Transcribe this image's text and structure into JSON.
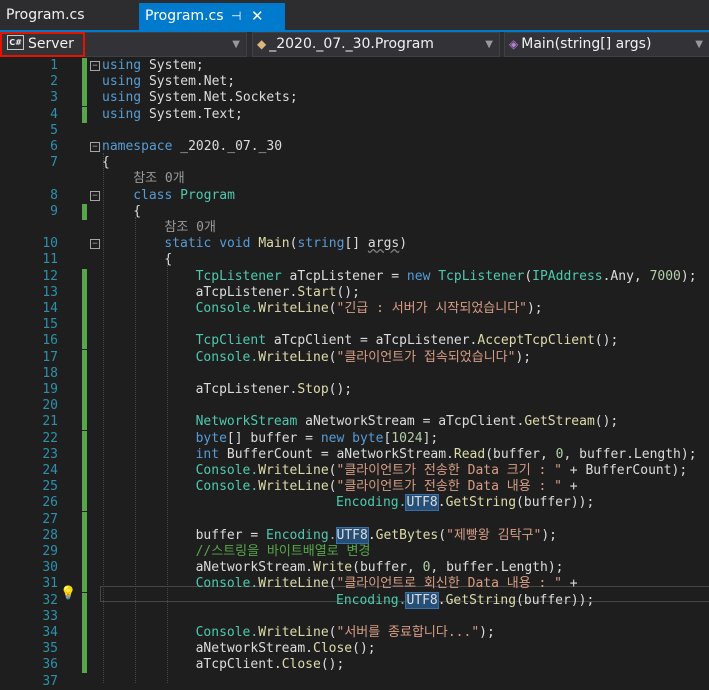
{
  "tabs": [
    {
      "label": "Program.cs",
      "active": false
    },
    {
      "label": "Program.cs",
      "active": true,
      "pin": "⊣",
      "close": "✕"
    }
  ],
  "navbar": {
    "project": "Server",
    "project_icon": "C#",
    "type": "_2020._07._30.Program",
    "member": "Main(string[] args)"
  },
  "code": {
    "ref_zero": "참조 0개",
    "lines": {
      "1": "using",
      "1b": "System;",
      "2": "using",
      "2b": "System.Net;",
      "3": "using",
      "3b": "System.Net.Sockets;",
      "4": "using",
      "4b": "System.Text;",
      "6a": "namespace",
      "6b": "_2020._07._30",
      "8a": "class",
      "8b": "Program",
      "10a": "static",
      "10b": "void",
      "10c": "Main",
      "10d": "string",
      "10e": "args",
      "12a": "TcpListener",
      "12b": "aTcpListener",
      "12c": "new",
      "12d": "TcpListener",
      "12e": "IPAddress",
      "12f": ".Any, ",
      "12g": "7000",
      "13a": "aTcpListener.",
      "13b": "Start",
      "14a": "Console.",
      "14b": "WriteLine",
      "14c": "\"긴급 : 서버가 시작되었습니다\"",
      "16a": "TcpClient",
      "16b": "aTcpClient",
      "16c": "aTcpListener.",
      "16d": "AcceptTcpClient",
      "17a": "Console.",
      "17b": "WriteLine",
      "17c": "\"클라이언트가 접속되었습니다\"",
      "19a": "aTcpListener.",
      "19b": "Stop",
      "21a": "NetworkStream",
      "21b": "aNetworkStream",
      "21c": "aTcpClient.",
      "21d": "GetStream",
      "22a": "byte",
      "22b": "buffer",
      "22c": "new",
      "22d": "byte",
      "22e": "1024",
      "23a": "int",
      "23b": "BufferCount",
      "23c": "aNetworkStream.",
      "23d": "Read",
      "23e": "(buffer, ",
      "23f": "0",
      "23g": ", buffer.Length);",
      "24a": "Console.",
      "24b": "WriteLine",
      "24c": "\"클라이언트가 전송한 Data 크기 : \"",
      "24d": " + BufferCount);",
      "25a": "Console.",
      "25b": "WriteLine",
      "25c": "\"클라이언트가 전송한 Data 내용 : \"",
      "25d": " +",
      "26a": "Encoding.",
      "26b": "UTF8",
      "26c": ".",
      "26d": "GetString",
      "26e": "(buffer));",
      "28a": "buffer",
      "28b": "Encoding.",
      "28c": "UTF8",
      "28d": ".",
      "28e": "GetBytes",
      "28f": "\"제빵왕 김탁구\"",
      "29": "//스트링을 바이트배열로 변경",
      "30a": "aNetworkStream.",
      "30b": "Write",
      "30c": "(buffer, ",
      "30d": "0",
      "30e": ", buffer.Length);",
      "31a": "Console.",
      "31b": "WriteLine",
      "31c": "\"클라이언트로 회신한 Data 내용 : \"",
      "31d": " +",
      "32a": "Encoding.",
      "32b": "UTF8",
      "32c": ".",
      "32d": "GetString",
      "32e": "(buffer));",
      "34a": "Console.",
      "34b": "WriteLine",
      "34c": "\"서버를 종료합니다...\"",
      "35a": "aNetworkStream.",
      "35b": "Close",
      "36a": "aTcpClient.",
      "36b": "Close"
    }
  },
  "line_numbers": [
    "1",
    "2",
    "3",
    "4",
    "5",
    "6",
    "7",
    "8",
    "9",
    "10",
    "11",
    "12",
    "13",
    "14",
    "15",
    "16",
    "17",
    "18",
    "19",
    "20",
    "21",
    "22",
    "23",
    "24",
    "25",
    "26",
    "27",
    "28",
    "29",
    "30",
    "31",
    "32",
    "33",
    "34",
    "35",
    "36",
    "37"
  ]
}
